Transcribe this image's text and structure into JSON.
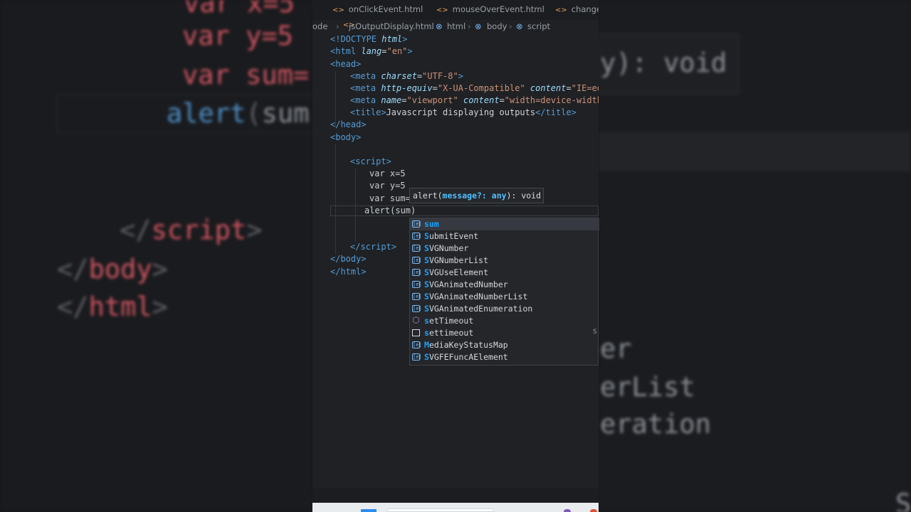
{
  "tabs": [
    {
      "label": "onClickEvent.html"
    },
    {
      "label": "mouseOverEvent.html"
    },
    {
      "label": "changeE"
    }
  ],
  "breadcrumb": {
    "root": "ode",
    "file": "jsOutputDisplay.html",
    "items": [
      "html",
      "body",
      "script"
    ]
  },
  "code": {
    "doctype_open": "<!DOCTYPE ",
    "doctype_html": "html",
    "doctype_close": ">",
    "html_open": "<html",
    "lang_attr": "lang",
    "eq": "=",
    "lang_val": "\"en\"",
    "gt": ">",
    "head_open": "<head>",
    "meta": "<meta",
    "charset_attr": "charset",
    "charset_val": "\"UTF-8\"",
    "http_equiv_attr": "http-equiv",
    "http_equiv_val": "\"X-UA-Compatible\"",
    "content_attr": "content",
    "content_val_1": "\"IE=edge",
    "name_attr": "name",
    "name_val": "\"viewport\"",
    "content_val_2": "\"width=device-width,",
    "title_open": "<title>",
    "title_text": "Javascript displaying outputs",
    "title_close": "</title>",
    "head_close": "</head>",
    "body_open": "<body>",
    "script_open": "<script>",
    "var_x": "var x=5",
    "var_y": "var y=5",
    "var_sum": "var sum=",
    "alert_fn": "alert",
    "alert_paren": "(",
    "alert_arg": "sum",
    "alert_close": ")",
    "script_close_lt": "</",
    "script_close_name": "script",
    "script_close_gt": ">",
    "body_close": "</body>",
    "html_close": "</html>"
  },
  "signature_help": {
    "fn": "alert(",
    "param": "message?: any",
    "ret": "): void"
  },
  "suggestions": [
    {
      "label": "sum",
      "icon": "variable-icon",
      "selected": true
    },
    {
      "label": "SubmitEvent",
      "icon": "variable-icon"
    },
    {
      "label": "SVGNumber",
      "icon": "variable-icon"
    },
    {
      "label": "SVGNumberList",
      "icon": "variable-icon"
    },
    {
      "label": "SVGUseElement",
      "icon": "variable-icon"
    },
    {
      "label": "SVGAnimatedNumber",
      "icon": "variable-icon"
    },
    {
      "label": "SVGAnimatedNumberList",
      "icon": "variable-icon"
    },
    {
      "label": "SVGAnimatedEnumeration",
      "icon": "variable-icon"
    },
    {
      "label": "setTimeout",
      "icon": "method-icon"
    },
    {
      "label": "settimeout",
      "icon": "snippet-icon"
    },
    {
      "label": "MediaKeyStatusMap",
      "icon": "variable-icon"
    },
    {
      "label": "SVGFEFuncAElement",
      "icon": "variable-icon"
    }
  ],
  "suggestion_side_text": "S",
  "background_zoom": {
    "left": {
      "line1": "var x=5",
      "line2": "var y=5",
      "line3": "var sum=",
      "alert_fn": "alert",
      "alert_paren": "(",
      "alert_arg": "sum",
      "script_close_lt": "</",
      "script_close_name": "script",
      "script_close_gt": ">",
      "body_close_lt": "</",
      "body_close_name": "body",
      "body_close_gt": ">",
      "html_close_lt": "</",
      "html_close_name": "html",
      "html_close_gt": ">"
    },
    "right": {
      "hint_frag": "y): void",
      "sug_frag_1": "er",
      "sug_frag_2": "erList",
      "sug_frag_3": "eration",
      "corner": "S"
    }
  },
  "colors": {
    "accent": "#18a3ff",
    "tag": "#569cd6",
    "attribute": "#9cdcfe",
    "string": "#ce9178",
    "keyword": "#c586c0"
  }
}
